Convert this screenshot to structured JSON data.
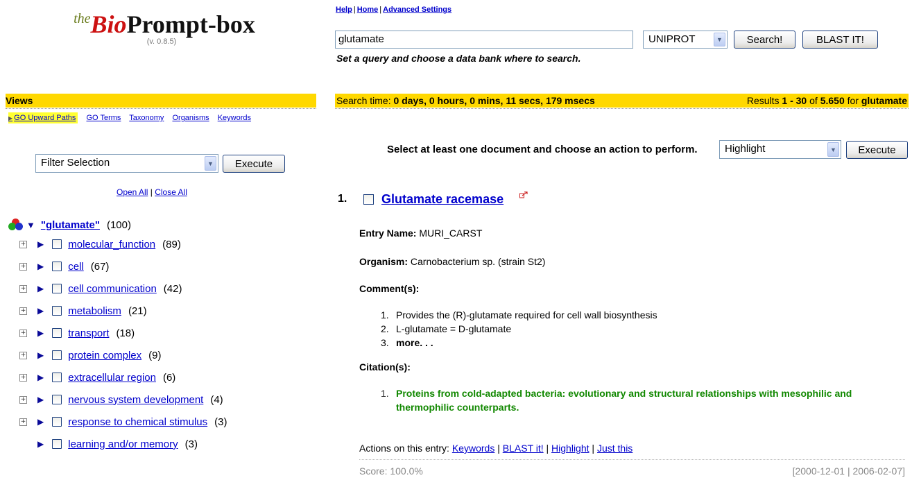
{
  "logo": {
    "the": "the",
    "bio": "Bio",
    "prompt": "Prompt-box",
    "version": "(v. 0.8.5)"
  },
  "top_links": [
    "Help",
    "Home",
    "Advanced Settings"
  ],
  "search": {
    "query": "glutamate",
    "databank": "UNIPROT",
    "search_button": "Search!",
    "blast_button": "BLAST IT!",
    "hint": "Set a query and choose a data bank where to search."
  },
  "views": {
    "header": "Views",
    "tabs": [
      "GO Upward Paths",
      "GO Terms",
      "Taxonomy",
      "Organisms",
      "Keywords"
    ],
    "filter_select": "Filter Selection",
    "execute": "Execute",
    "open_all": "Open All",
    "close_all": "Close All"
  },
  "tree": {
    "root_label": "\"glutamate\"",
    "root_count": "(100)",
    "items": [
      {
        "label": "molecular_function",
        "count": "(89)",
        "expandable": true
      },
      {
        "label": "cell",
        "count": "(67)",
        "expandable": true
      },
      {
        "label": "cell communication",
        "count": "(42)",
        "expandable": true
      },
      {
        "label": "metabolism",
        "count": "(21)",
        "expandable": true
      },
      {
        "label": "transport",
        "count": "(18)",
        "expandable": true
      },
      {
        "label": "protein complex",
        "count": "(9)",
        "expandable": true
      },
      {
        "label": "extracellular region",
        "count": "(6)",
        "expandable": true
      },
      {
        "label": "nervous system development",
        "count": "(4)",
        "expandable": true
      },
      {
        "label": "response to chemical stimulus",
        "count": "(3)",
        "expandable": true
      },
      {
        "label": "learning and/or memory",
        "count": "(3)",
        "expandable": false
      }
    ]
  },
  "results_bar": {
    "time_label": "Search time:",
    "time_value": "0 days, 0 hours, 0 mins, 11 secs, 179 msecs",
    "results_prefix": "Results",
    "range": "1 - 30",
    "of": "of",
    "total": "5.650",
    "for": "for",
    "query": "glutamate"
  },
  "doc_actions": {
    "prompt": "Select at least one document and choose an action to perform.",
    "action": "Highlight",
    "execute": "Execute"
  },
  "result": {
    "number": "1.",
    "title": "Glutamate racemase",
    "entry_name_label": "Entry Name:",
    "entry_name": "MURI_CARST",
    "organism_label": "Organism:",
    "organism": "Carnobacterium sp. (strain St2)",
    "comments_label": "Comment(s):",
    "comments": [
      "Provides the (R)-glutamate required for cell wall biosynthesis",
      "L-glutamate = D-glutamate",
      "more. . ."
    ],
    "citations_label": "Citation(s):",
    "citations": [
      "Proteins from cold-adapted bacteria: evolutionary and structural relationships with mesophilic and thermophilic counterparts."
    ],
    "actions_label": "Actions on this entry:",
    "actions": [
      "Keywords",
      "BLAST it!",
      "Highlight",
      "Just this"
    ],
    "score": "Score: 100.0%",
    "dates": "[2000-12-01 | 2006-02-07]"
  }
}
